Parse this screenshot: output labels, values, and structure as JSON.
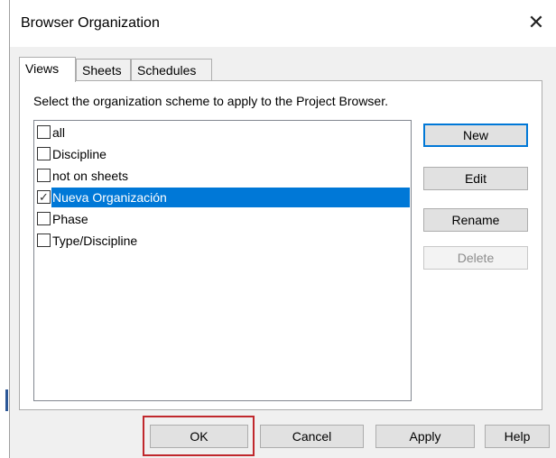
{
  "dialog": {
    "title": "Browser Organization",
    "close_symbol": "✕"
  },
  "tabs": [
    {
      "label": "Views",
      "active": true
    },
    {
      "label": "Sheets",
      "active": false
    },
    {
      "label": "Schedules",
      "active": false
    }
  ],
  "instruction": "Select the organization scheme to apply to the Project Browser.",
  "schemes": [
    {
      "label": "all",
      "checked": false,
      "selected": false
    },
    {
      "label": "Discipline",
      "checked": false,
      "selected": false
    },
    {
      "label": "not on sheets",
      "checked": false,
      "selected": false
    },
    {
      "label": "Nueva Organización",
      "checked": true,
      "selected": true
    },
    {
      "label": "Phase",
      "checked": false,
      "selected": false
    },
    {
      "label": "Type/Discipline",
      "checked": false,
      "selected": false
    }
  ],
  "side_buttons": {
    "new": "New",
    "edit": "Edit",
    "rename": "Rename",
    "delete": "Delete"
  },
  "footer_buttons": {
    "ok": "OK",
    "cancel": "Cancel",
    "apply": "Apply",
    "help": "Help"
  },
  "colors": {
    "selection": "#0078d7",
    "highlight_box": "#c0282d"
  }
}
